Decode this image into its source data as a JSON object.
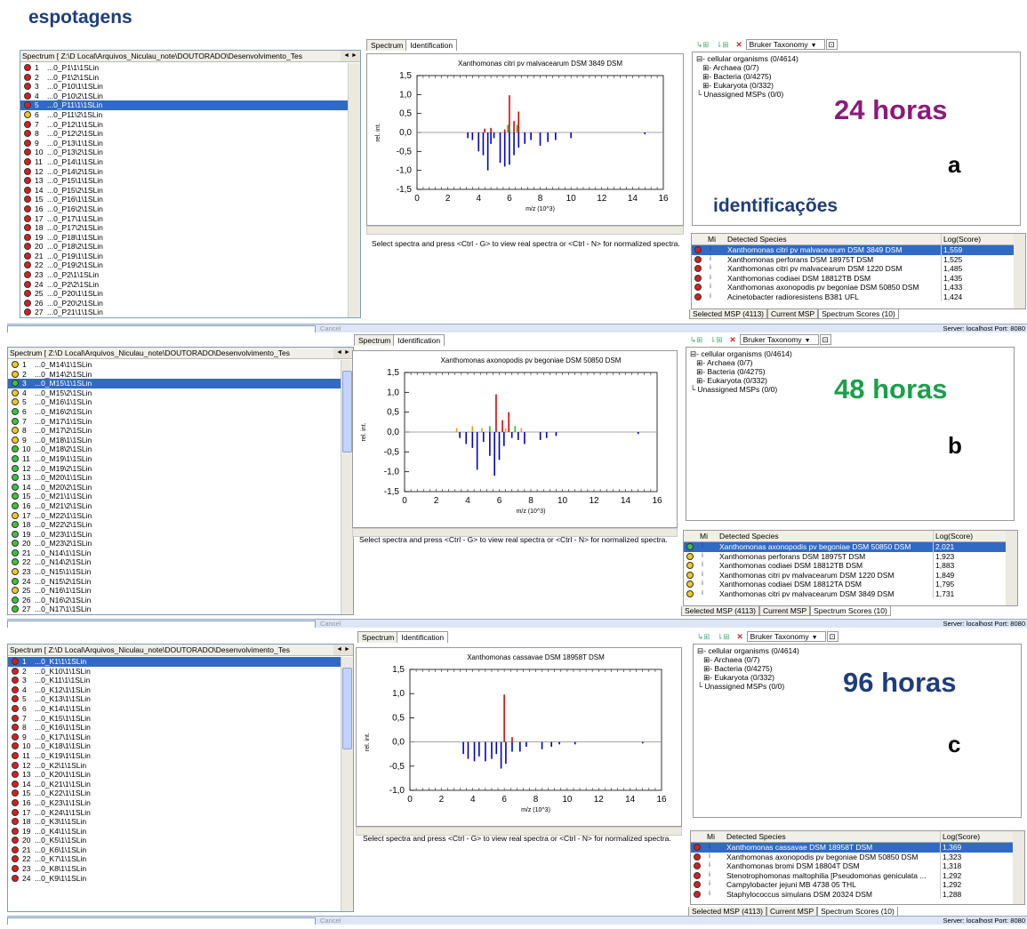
{
  "header": {
    "title": "espotagens"
  },
  "ident_label": "identificações",
  "common": {
    "spectrum_title": "Spectrum [ Z:\\D Local\\Arquivos_Niculau_note\\DOUTORADO\\Desenvolvimento_Tes",
    "tab_spectrum": "Spectrum",
    "tab_identification": "Identification",
    "message": "Select spectra and press <Ctrl - G>  to view real spectra or <Ctrl - N> for normalized spectra.",
    "taxonomy": "Bruker Taxonomy",
    "tree": [
      "cellular organisms (0/4614)",
      "Archaea (0/7)",
      "Bacteria (0/4275)",
      "Eukaryota (0/332)",
      "Unassigned MSPs (0/0)"
    ],
    "col_mi": "Mi",
    "col_species": "Detected Species",
    "col_score": "Log(Score)",
    "btab_selected": "Selected MSP (4113)",
    "btab_current": "Current MSP",
    "btab_scores": "Spectrum Scores (10)",
    "cancel": "Cancel",
    "server": "Server: localhost Port: 8080",
    "xlabel": "m/z (10^3)",
    "ylabel": "rel. int."
  },
  "panels": [
    {
      "time": "24 horas",
      "time_color": "#8b1a7a",
      "letter": "a",
      "chart_title": "Xanthomonas citri pv malvacearum DSM 3849 DSM",
      "list": [
        {
          "n": "1",
          "name": "...0_P1\\1\\1SLin",
          "c": "red"
        },
        {
          "n": "2",
          "name": "...0_P1\\2\\1SLin",
          "c": "red"
        },
        {
          "n": "3",
          "name": "...0_P10\\1\\1SLin",
          "c": "red"
        },
        {
          "n": "4",
          "name": "...0_P10\\2\\1SLin",
          "c": "red"
        },
        {
          "n": "5",
          "name": "...0_P11\\1\\1SLin",
          "c": "red",
          "sel": true
        },
        {
          "n": "6",
          "name": "...0_P11\\2\\1SLin",
          "c": "yellow"
        },
        {
          "n": "7",
          "name": "...0_P12\\1\\1SLin",
          "c": "red"
        },
        {
          "n": "8",
          "name": "...0_P12\\2\\1SLin",
          "c": "red"
        },
        {
          "n": "9",
          "name": "...0_P13\\1\\1SLin",
          "c": "red"
        },
        {
          "n": "10",
          "name": "...0_P13\\2\\1SLin",
          "c": "red"
        },
        {
          "n": "11",
          "name": "...0_P14\\1\\1SLin",
          "c": "red"
        },
        {
          "n": "12",
          "name": "...0_P14\\2\\1SLin",
          "c": "red"
        },
        {
          "n": "13",
          "name": "...0_P15\\1\\1SLin",
          "c": "red"
        },
        {
          "n": "14",
          "name": "...0_P15\\2\\1SLin",
          "c": "red"
        },
        {
          "n": "15",
          "name": "...0_P16\\1\\1SLin",
          "c": "red"
        },
        {
          "n": "16",
          "name": "...0_P16\\2\\1SLin",
          "c": "red"
        },
        {
          "n": "17",
          "name": "...0_P17\\1\\1SLin",
          "c": "red"
        },
        {
          "n": "18",
          "name": "...0_P17\\2\\1SLin",
          "c": "red"
        },
        {
          "n": "19",
          "name": "...0_P18\\1\\1SLin",
          "c": "red"
        },
        {
          "n": "20",
          "name": "...0_P18\\2\\1SLin",
          "c": "red"
        },
        {
          "n": "21",
          "name": "...0_P19\\1\\1SLin",
          "c": "red"
        },
        {
          "n": "22",
          "name": "...0_P19\\2\\1SLin",
          "c": "red"
        },
        {
          "n": "23",
          "name": "...0_P2\\1\\1SLin",
          "c": "red"
        },
        {
          "n": "24",
          "name": "...0_P2\\2\\1SLin",
          "c": "red"
        },
        {
          "n": "25",
          "name": "...0_P20\\1\\1SLin",
          "c": "red"
        },
        {
          "n": "26",
          "name": "...0_P20\\2\\1SLin",
          "c": "red"
        },
        {
          "n": "27",
          "name": "...0_P21\\1\\1SLin",
          "c": "red"
        }
      ],
      "species": [
        {
          "c": "red",
          "name": "Xanthomonas citri pv malvacearum DSM 3849 DSM",
          "score": "1,559",
          "sel": true
        },
        {
          "c": "red",
          "name": "Xanthomonas perforans DSM 18975T DSM",
          "score": "1,525"
        },
        {
          "c": "red",
          "name": "Xanthomonas citri pv malvacearum DSM 1220 DSM",
          "score": "1,485"
        },
        {
          "c": "red",
          "name": "Xanthomonas codiaei DSM 18812TB DSM",
          "score": "1,435"
        },
        {
          "c": "red",
          "name": "Xanthomonas axonopodis pv begoniae DSM 50850 DSM",
          "score": "1,433"
        },
        {
          "c": "red",
          "name": "Acinetobacter radioresistens B381 UFL",
          "score": "1,424"
        }
      ],
      "ylim": [
        -1.5,
        1.5
      ],
      "yticks": [
        "1,5",
        "1,0",
        "0,5",
        "0,0",
        "-0,5",
        "-1,0",
        "-1,5"
      ],
      "xticks": [
        "0",
        "2",
        "4",
        "6",
        "8",
        "10",
        "12",
        "14",
        "16"
      ]
    },
    {
      "time": "48 horas",
      "time_color": "#1aa04a",
      "letter": "b",
      "chart_title": "Xanthomonas axonopodis pv begoniae DSM 50850 DSM",
      "list": [
        {
          "n": "1",
          "name": "...0_M14\\1\\1SLin",
          "c": "yellow"
        },
        {
          "n": "2",
          "name": "...0_M14\\2\\1SLin",
          "c": "yellow"
        },
        {
          "n": "3",
          "name": "...0_M15\\1\\1SLin",
          "c": "green",
          "sel": true
        },
        {
          "n": "4",
          "name": "...0_M15\\2\\1SLin",
          "c": "yellow"
        },
        {
          "n": "5",
          "name": "...0_M16\\1\\1SLin",
          "c": "yellow"
        },
        {
          "n": "6",
          "name": "...0_M16\\2\\1SLin",
          "c": "green"
        },
        {
          "n": "7",
          "name": "...0_M17\\1\\1SLin",
          "c": "green"
        },
        {
          "n": "8",
          "name": "...0_M17\\2\\1SLin",
          "c": "yellow"
        },
        {
          "n": "9",
          "name": "...0_M18\\1\\1SLin",
          "c": "yellow"
        },
        {
          "n": "10",
          "name": "...0_M18\\2\\1SLin",
          "c": "green"
        },
        {
          "n": "11",
          "name": "...0_M19\\1\\1SLin",
          "c": "green"
        },
        {
          "n": "12",
          "name": "...0_M19\\2\\1SLin",
          "c": "green"
        },
        {
          "n": "13",
          "name": "...0_M20\\1\\1SLin",
          "c": "green"
        },
        {
          "n": "14",
          "name": "...0_M20\\2\\1SLin",
          "c": "green"
        },
        {
          "n": "15",
          "name": "...0_M21\\1\\1SLin",
          "c": "green"
        },
        {
          "n": "16",
          "name": "...0_M21\\2\\1SLin",
          "c": "green"
        },
        {
          "n": "17",
          "name": "...0_M22\\1\\1SLin",
          "c": "yellow"
        },
        {
          "n": "18",
          "name": "...0_M22\\2\\1SLin",
          "c": "green"
        },
        {
          "n": "19",
          "name": "...0_M23\\1\\1SLin",
          "c": "green"
        },
        {
          "n": "20",
          "name": "...0_M23\\2\\1SLin",
          "c": "green"
        },
        {
          "n": "21",
          "name": "...0_N14\\1\\1SLin",
          "c": "green"
        },
        {
          "n": "22",
          "name": "...0_N14\\2\\1SLin",
          "c": "green"
        },
        {
          "n": "23",
          "name": "...0_N15\\1\\1SLin",
          "c": "yellow"
        },
        {
          "n": "24",
          "name": "...0_N15\\2\\1SLin",
          "c": "green"
        },
        {
          "n": "25",
          "name": "...0_N16\\1\\1SLin",
          "c": "yellow"
        },
        {
          "n": "26",
          "name": "...0_N16\\2\\1SLin",
          "c": "green"
        },
        {
          "n": "27",
          "name": "...0_N17\\1\\1SLin",
          "c": "green"
        }
      ],
      "species": [
        {
          "c": "green",
          "name": "Xanthomonas axonopodis pv begoniae DSM 50850 DSM",
          "score": "2,021",
          "sel": true
        },
        {
          "c": "yellow",
          "name": "Xanthomonas perforans DSM 18975T DSM",
          "score": "1,923"
        },
        {
          "c": "yellow",
          "name": "Xanthomonas codiaei DSM 18812TB DSM",
          "score": "1,883"
        },
        {
          "c": "yellow",
          "name": "Xanthomonas citri pv malvacearum DSM 1220 DSM",
          "score": "1,849"
        },
        {
          "c": "yellow",
          "name": "Xanthomonas codiaei DSM 18812TA DSM",
          "score": "1,795"
        },
        {
          "c": "yellow",
          "name": "Xanthomonas citri pv malvacearum DSM 3849 DSM",
          "score": "1,731"
        }
      ],
      "ylim": [
        -1.5,
        1.5
      ],
      "yticks": [
        "1,5",
        "1,0",
        "0,5",
        "0,0",
        "-0,5",
        "-1,0",
        "-1,5"
      ],
      "xticks": [
        "0",
        "2",
        "4",
        "6",
        "8",
        "10",
        "12",
        "14",
        "16"
      ]
    },
    {
      "time": "96 horas",
      "time_color": "#1f3d7a",
      "letter": "c",
      "chart_title": "Xanthomonas cassavae DSM 18958T DSM",
      "list": [
        {
          "n": "1",
          "name": "...0_K1\\1\\1SLin",
          "c": "red",
          "sel": true
        },
        {
          "n": "2",
          "name": "...0_K10\\1\\1SLin",
          "c": "red"
        },
        {
          "n": "3",
          "name": "...0_K11\\1\\1SLin",
          "c": "red"
        },
        {
          "n": "4",
          "name": "...0_K12\\1\\1SLin",
          "c": "red"
        },
        {
          "n": "5",
          "name": "...0_K13\\1\\1SLin",
          "c": "red"
        },
        {
          "n": "6",
          "name": "...0_K14\\1\\1SLin",
          "c": "red"
        },
        {
          "n": "7",
          "name": "...0_K15\\1\\1SLin",
          "c": "red"
        },
        {
          "n": "8",
          "name": "...0_K16\\1\\1SLin",
          "c": "red"
        },
        {
          "n": "9",
          "name": "...0_K17\\1\\1SLin",
          "c": "red"
        },
        {
          "n": "10",
          "name": "...0_K18\\1\\1SLin",
          "c": "red"
        },
        {
          "n": "11",
          "name": "...0_K19\\1\\1SLin",
          "c": "red"
        },
        {
          "n": "12",
          "name": "...0_K2\\1\\1SLin",
          "c": "red"
        },
        {
          "n": "13",
          "name": "...0_K20\\1\\1SLin",
          "c": "red"
        },
        {
          "n": "14",
          "name": "...0_K21\\1\\1SLin",
          "c": "red"
        },
        {
          "n": "15",
          "name": "...0_K22\\1\\1SLin",
          "c": "red"
        },
        {
          "n": "16",
          "name": "...0_K23\\1\\1SLin",
          "c": "red"
        },
        {
          "n": "17",
          "name": "...0_K24\\1\\1SLin",
          "c": "red"
        },
        {
          "n": "18",
          "name": "...0_K3\\1\\1SLin",
          "c": "red"
        },
        {
          "n": "19",
          "name": "...0_K4\\1\\1SLin",
          "c": "red"
        },
        {
          "n": "20",
          "name": "...0_K5\\1\\1SLin",
          "c": "red"
        },
        {
          "n": "21",
          "name": "...0_K6\\1\\1SLin",
          "c": "red"
        },
        {
          "n": "22",
          "name": "...0_K7\\1\\1SLin",
          "c": "red"
        },
        {
          "n": "23",
          "name": "...0_K8\\1\\1SLin",
          "c": "red"
        },
        {
          "n": "24",
          "name": "...0_K9\\1\\1SLin",
          "c": "red"
        }
      ],
      "species": [
        {
          "c": "red",
          "name": "Xanthomonas cassavae DSM 18958T DSM",
          "score": "1,369",
          "sel": true
        },
        {
          "c": "red",
          "name": "Xanthomonas axonopodis pv begoniae DSM 50850 DSM",
          "score": "1,323"
        },
        {
          "c": "red",
          "name": "Xanthomonas bromi DSM 18804T DSM",
          "score": "1,318"
        },
        {
          "c": "red",
          "name": "Stenotrophomonas  maltophilia [Pseudomonas  geniculata  ...",
          "score": "1,292"
        },
        {
          "c": "red",
          "name": "Campylobacter jejuni MB  4738  05 THL",
          "score": "1,292"
        },
        {
          "c": "red",
          "name": "Staphylococcus simulans DSM 20324 DSM",
          "score": "1,288"
        }
      ],
      "ylim": [
        -1.0,
        1.5
      ],
      "yticks": [
        "1,5",
        "1,0",
        "0,5",
        "0,0",
        "-0,5",
        "-1,0"
      ],
      "xticks": [
        "0",
        "2",
        "4",
        "6",
        "8",
        "10",
        "12",
        "14",
        "16"
      ]
    }
  ],
  "chart_data": [
    {
      "type": "bar",
      "title": "Xanthomonas citri pv malvacearum DSM 3849 DSM",
      "xlabel": "m/z (10^3)",
      "ylabel": "rel. int.",
      "xlim": [
        0,
        16
      ],
      "ylim": [
        -1.5,
        1.5
      ],
      "series": [
        {
          "color": "red",
          "x": [
            4.4,
            4.8,
            5.7,
            6.0,
            6.3,
            6.6
          ],
          "values": [
            0.1,
            0.12,
            0.08,
            0.98,
            0.3,
            0.55
          ]
        },
        {
          "color": "green",
          "x": [
            5.9,
            6.5
          ],
          "values": [
            0.2,
            0.2
          ]
        },
        {
          "color": "blue",
          "x": [
            3.3,
            3.6,
            4.0,
            4.3,
            4.6,
            4.8,
            5.0,
            5.4,
            5.7,
            6.0,
            6.3,
            6.6,
            7.0,
            7.4,
            8.0,
            8.5,
            9.0,
            10.0,
            14.8
          ],
          "values": [
            -0.15,
            -0.2,
            -0.5,
            -0.6,
            -1.0,
            -0.3,
            -0.15,
            -0.8,
            -0.9,
            -0.85,
            -0.6,
            -0.4,
            -0.3,
            -0.2,
            -0.35,
            -0.25,
            -0.2,
            -0.15,
            -0.05
          ]
        }
      ]
    },
    {
      "type": "bar",
      "title": "Xanthomonas axonopodis pv begoniae DSM 50850 DSM",
      "xlabel": "m/z (10^3)",
      "ylabel": "rel. int.",
      "xlim": [
        0,
        16
      ],
      "ylim": [
        -1.5,
        1.5
      ],
      "series": [
        {
          "color": "red",
          "x": [
            5.8,
            6.2,
            6.6
          ],
          "values": [
            0.95,
            0.3,
            0.5
          ]
        },
        {
          "color": "orange",
          "x": [
            3.3,
            4.3,
            4.9,
            6.4,
            7.4
          ],
          "values": [
            0.1,
            0.15,
            0.1,
            0.1,
            0.1
          ]
        },
        {
          "color": "green",
          "x": [
            5.4,
            7.0
          ],
          "values": [
            0.15,
            0.15
          ]
        },
        {
          "color": "blue",
          "x": [
            3.5,
            3.9,
            4.3,
            4.6,
            5.0,
            5.4,
            5.7,
            6.0,
            6.3,
            6.8,
            7.2,
            7.6,
            8.6,
            9.0,
            9.6,
            14.8
          ],
          "values": [
            -0.15,
            -0.3,
            -0.4,
            -0.95,
            -0.25,
            -0.6,
            -1.1,
            -0.7,
            -0.35,
            -0.15,
            -0.2,
            -0.3,
            -0.2,
            -0.15,
            -0.1,
            -0.05
          ]
        }
      ]
    },
    {
      "type": "bar",
      "title": "Xanthomonas cassavae DSM 18958T DSM",
      "xlabel": "m/z (10^3)",
      "ylabel": "rel. int.",
      "xlim": [
        0,
        16
      ],
      "ylim": [
        -1.0,
        1.5
      ],
      "series": [
        {
          "color": "red",
          "x": [
            6.0,
            6.5
          ],
          "values": [
            0.98,
            0.1
          ]
        },
        {
          "color": "blue",
          "x": [
            3.4,
            3.7,
            4.1,
            4.4,
            4.8,
            5.2,
            5.5,
            5.8,
            6.1,
            6.5,
            7.0,
            7.4,
            8.4,
            9.0,
            9.5,
            10.5,
            14.8
          ],
          "values": [
            -0.25,
            -0.35,
            -0.4,
            -0.3,
            -0.4,
            -0.35,
            -0.25,
            -0.55,
            -0.45,
            -0.2,
            -0.2,
            -0.1,
            -0.15,
            -0.1,
            -0.05,
            -0.05,
            -0.03
          ]
        }
      ]
    }
  ]
}
